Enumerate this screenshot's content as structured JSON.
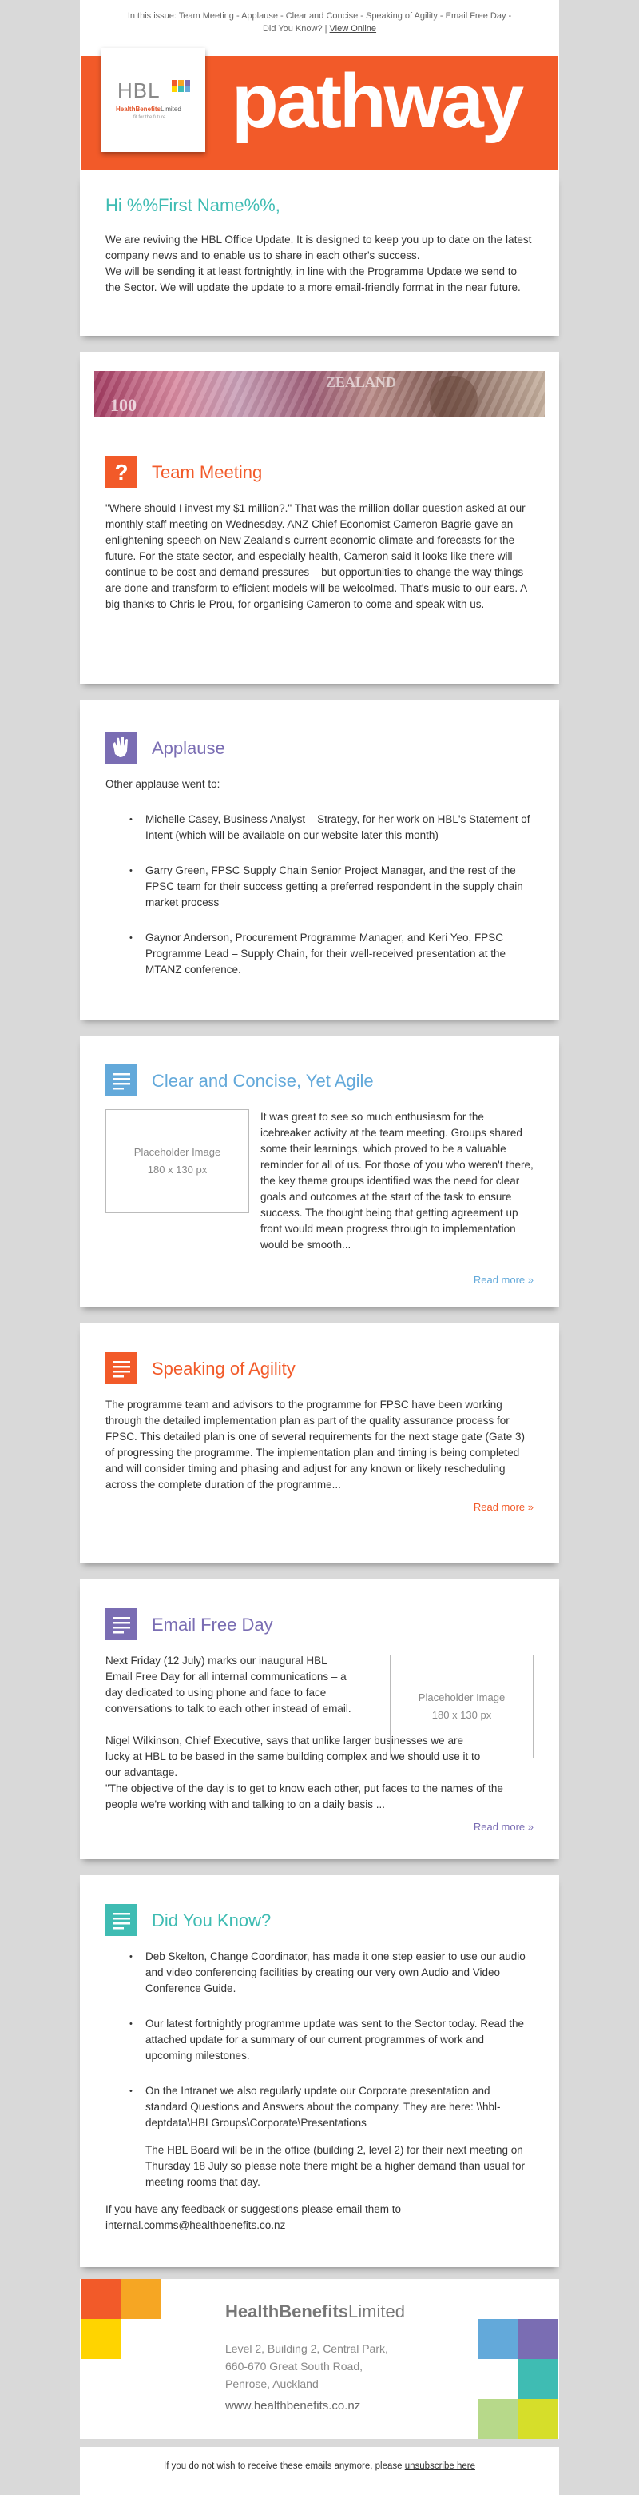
{
  "top_bar": {
    "issue_text": "In this issue: Team Meeting - Applause - Clear and Concise - Speaking of Agility - Email Free Day -",
    "issue_text2": "Did You Know? |",
    "view_online": "View Online"
  },
  "header": {
    "logo_text": "HBL",
    "logo_name_a": "HealthBenefits",
    "logo_name_b": "Limited",
    "logo_tagline": "fit for the future",
    "masthead": "pathway",
    "colors": {
      "orange": "#f25a29",
      "teal": "#3fbcb3",
      "purple": "#7a6db3",
      "blue": "#63a9da"
    }
  },
  "intro": {
    "greeting": "Hi %%First Name%%,",
    "p1": "We are reviving the HBL Office Update. It is designed to keep you up to date on the latest company news and to enable us to share in each other's success.",
    "p2": "We will be sending it at least fortnightly, in line with the Programme Update we send to the Sector. We will update the update to a more email-friendly format in the near future."
  },
  "team_meeting": {
    "icon": "question-icon",
    "title": "Team Meeting",
    "body": "\"Where should I invest my $1 million?.\" That was the million dollar question asked at our monthly staff meeting on Wednesday. ANZ Chief Economist Cameron Bagrie gave an enlightening speech on New Zealand's current economic climate and forecasts for the future.  For the state sector, and especially health, Cameron said it looks like there will continue to be cost and demand pressures – but opportunities to change the way things are done and transform to efficient models will be welcolmed. That's music to our ears. A big thanks to Chris le Prou, for organising Cameron to come and speak with us."
  },
  "applause": {
    "icon": "clapping-hands-icon",
    "title": "Applause",
    "lead": "Other applause went to:",
    "items": [
      "Michelle Casey, Business Analyst – Strategy, for her work on HBL's Statement of Intent (which will be available on our website later this month)",
      "Garry Green, FPSC Supply Chain Senior Project Manager, and the rest of the FPSC team for their success getting a preferred respondent in the supply chain market process",
      "Gaynor Anderson, Procurement Programme Manager, and Keri Yeo, FPSC Programme Lead – Supply Chain, for their well-received presentation at the MTANZ conference."
    ]
  },
  "clear_concise": {
    "icon": "document-lines-icon",
    "title": "Clear and Concise, Yet Agile",
    "placeholder_1": "Placeholder Image",
    "placeholder_2": "180 x 130 px",
    "body": "It was great to see so much enthusiasm for the icebreaker activity at the team meeting. Groups shared some their learnings, which proved to be a valuable reminder for all of us. For those of you who weren't there, the key theme groups identified was the need for clear goals and outcomes at the start of the task to ensure success. The thought being that getting agreement up front would mean progress through to implementation would be smooth...",
    "read_more": "Read more »"
  },
  "agility": {
    "icon": "document-lines-icon",
    "title": "Speaking of Agility",
    "body": "The programme team and advisors to the programme for FPSC have been working through the detailed implementation plan as part of the quality assurance process for FPSC.  This detailed plan is one of several requirements for the next stage gate (Gate 3) of progressing the programme. The implementation plan and timing is being completed and will consider timing and phasing and adjust for any known or likely rescheduling across the complete duration of the programme...",
    "read_more": "Read more »"
  },
  "email_free": {
    "icon": "document-lines-icon",
    "title": "Email Free Day",
    "p1": "Next Friday (12 July) marks our inaugural HBL Email Free Day for all internal communications – a day dedicated to using phone and face to face conversations to talk to each other instead of email.",
    "p2": "Nigel Wilkinson, Chief Executive, says that unlike larger businesses we are lucky at HBL to be based in the same building complex and we should use it to our advantage.",
    "p3": "\"The objective of the day is to get to know each other, put faces to the names of the people we're working with and talking to on a daily basis ...",
    "placeholder_1": "Placeholder Image",
    "placeholder_2": "180 x 130 px",
    "read_more": "Read more »"
  },
  "did_you_know": {
    "icon": "document-lines-icon",
    "title": "Did You Know?",
    "items": [
      "Deb Skelton, Change Coordinator, has made it one step easier to use our audio and video conferencing facilities by creating our very own Audio and Video Conference Guide.",
      "Our latest fortnightly programme update was sent to the Sector today. Read the attached update for a summary of our current programmes of work and upcoming milestones.",
      "On the Intranet we also regularly update our Corporate presentation and standard Questions and Answers about the company. They are here: \\\\hbl-deptdata\\HBLGroups\\Corporate\\Presentations"
    ],
    "board_note": "The HBL Board will be in the office (building 2, level 2) for their next meeting on Thursday 18 July so please note there might be a higher demand than usual for meeting rooms that day.",
    "feedback": "If you have any feedback or suggestions please email them to",
    "email": "internal.comms@healthbenefits.co.nz"
  },
  "footer": {
    "company_a": "HealthBenefits",
    "company_b": "Limited",
    "addr1": "Level 2, Building 2, Central Park,",
    "addr2": "660-670 Great South Road,",
    "addr3": "Penrose, Auckland",
    "website": "www.healthbenefits.co.nz"
  },
  "unsubscribe": {
    "text": "If you do not wish to receive these emails anymore, please",
    "link": "unsubscribe here"
  }
}
